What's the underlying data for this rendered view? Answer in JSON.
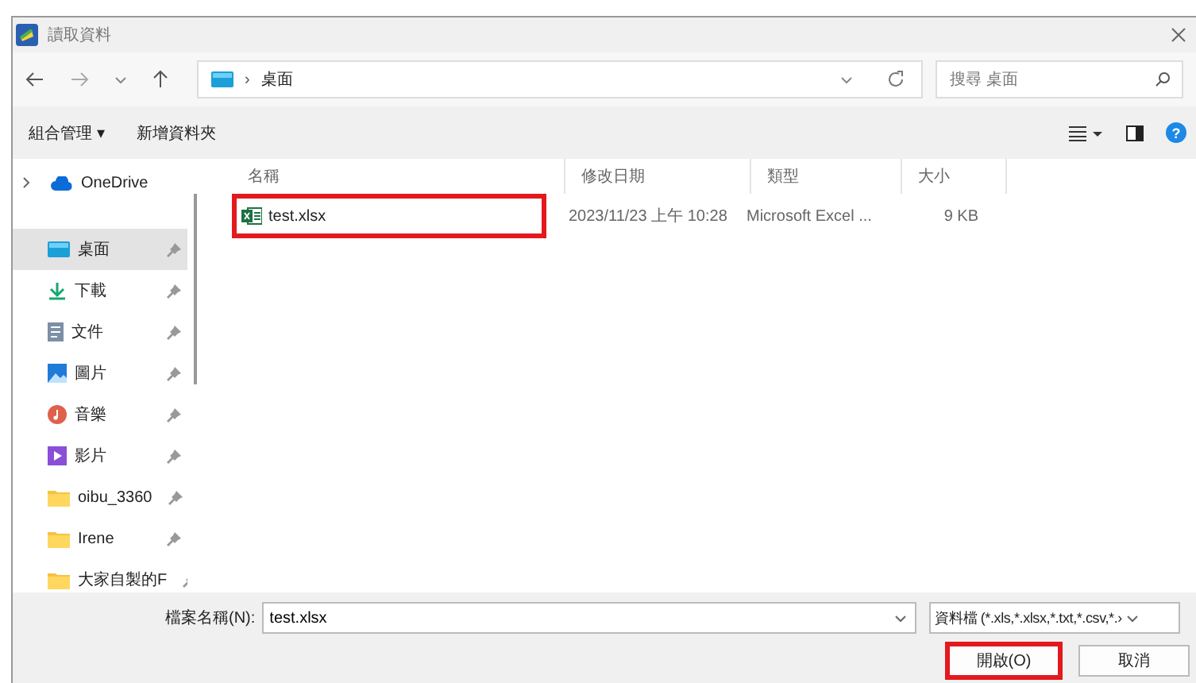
{
  "window": {
    "title": "讀取資料"
  },
  "nav": {
    "separator": "›",
    "path": [
      "桌面"
    ],
    "search": {
      "placeholder": "搜尋 桌面"
    }
  },
  "toolbar": {
    "organize": "組合管理 ▾",
    "new_folder": "新增資料夾",
    "help": "?"
  },
  "sidebar": {
    "items": [
      {
        "label": "OneDrive",
        "kind": "cloud",
        "pinned": false,
        "selected": false
      },
      {
        "label": "桌面",
        "kind": "desktop",
        "pinned": true,
        "selected": true
      },
      {
        "label": "下載",
        "kind": "download",
        "pinned": true,
        "selected": false
      },
      {
        "label": "文件",
        "kind": "document",
        "pinned": true,
        "selected": false
      },
      {
        "label": "圖片",
        "kind": "picture",
        "pinned": true,
        "selected": false
      },
      {
        "label": "音樂",
        "kind": "music",
        "pinned": true,
        "selected": false
      },
      {
        "label": "影片",
        "kind": "video",
        "pinned": true,
        "selected": false
      },
      {
        "label": "oibu_3360",
        "kind": "folder",
        "pinned": true,
        "selected": false
      },
      {
        "label": "Irene",
        "kind": "folder",
        "pinned": true,
        "selected": false
      },
      {
        "label": "大家自製的F",
        "kind": "folder",
        "pinned": true,
        "selected": false
      }
    ]
  },
  "table": {
    "columns": [
      "名稱",
      "修改日期",
      "類型",
      "大小"
    ],
    "rows": [
      {
        "name": "test.xlsx",
        "modified": "2023/11/23 上午 10:28",
        "type": "Microsoft Excel ...",
        "size": "9 KB",
        "highlighted": true
      }
    ]
  },
  "footer": {
    "filename_label": "檔案名稱(N):",
    "filename": "test.xlsx",
    "filter": "資料檔 (*.xls,*.xlsx,*.txt,*.csv,*.›",
    "open": {
      "label": "開啟(O)",
      "highlighted": true
    },
    "cancel": "取消"
  }
}
